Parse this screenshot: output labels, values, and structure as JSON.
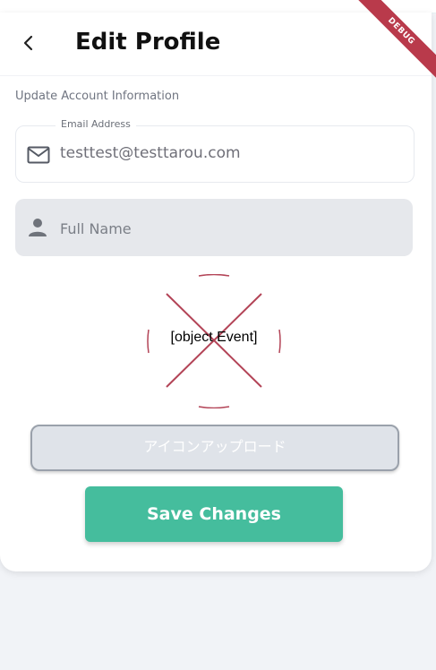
{
  "header": {
    "title": "Edit Profile",
    "back_icon": "chevron-left-icon",
    "debug_banner": "DEBUG"
  },
  "section_label": "Update Account Information",
  "email": {
    "label": "Email Address",
    "value": "testtest@testtarou.com",
    "icon": "mail-icon"
  },
  "full_name": {
    "placeholder": "Full Name",
    "value": "",
    "icon": "person-icon"
  },
  "avatar": {
    "text": "[object Event]",
    "icon": "broken-image-x-icon"
  },
  "buttons": {
    "upload_label": "アイコンアップロード",
    "save_label": "Save Changes"
  },
  "colors": {
    "primary": "#45bd9d",
    "debug": "#b93a4b",
    "error_x": "#b34457"
  }
}
